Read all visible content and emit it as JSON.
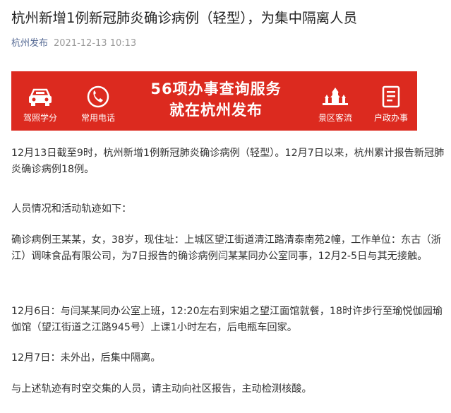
{
  "article": {
    "title": "杭州新增1例新冠肺炎确诊病例（轻型），为集中隔离人员",
    "source": "杭州发布",
    "date": "2021-12-13 10:13"
  },
  "banner": {
    "headline_line1": "56项办事查询服务",
    "headline_line2": "就在杭州发布",
    "items": [
      {
        "label": "驾照学分",
        "icon": "car-icon"
      },
      {
        "label": "常用电话",
        "icon": "phone-icon"
      },
      {
        "label": "景区客流",
        "icon": "pagoda-icon"
      },
      {
        "label": "户政办事",
        "icon": "document-icon"
      }
    ],
    "background_color": "#dc2a1f"
  },
  "paragraphs": [
    "12月13日截至9时，杭州新增1例新冠肺炎确诊病例（轻型）。12月7日以来，杭州累计报告新冠肺炎确诊病例18例。",
    "人员情况和活动轨迹如下：",
    "确诊病例王某某，女，38岁，现住址：上城区望江街道清江路清泰南苑2幢，工作单位：东古（浙江）调味食品有限公司，为7日报告的确诊病例闫某某同办公室同事，12月2-5日与其无接触。",
    "12月6日：与闫某某同办公室上班，12:20左右到宋姐之望江面馆就餐，18时许步行至瑜悦伽园瑜伽馆（望江街道之江路945号）上课1小时左右，后电瓶车回家。",
    "12月7日：未外出，后集中隔离。",
    "与上述轨迹有时空交集的人员，请主动向社区报告，主动检测核酸。"
  ]
}
